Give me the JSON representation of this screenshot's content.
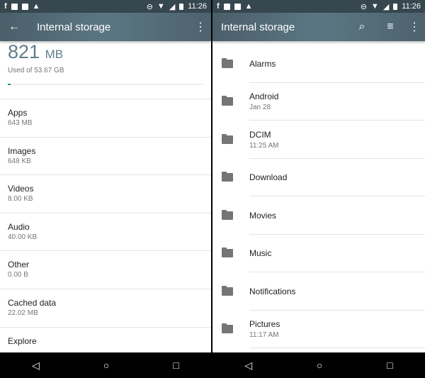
{
  "status": {
    "time": "11:26",
    "left_icons": [
      "facebook-icon",
      "image-icon",
      "gmail-icon",
      "warning-icon"
    ],
    "right_icons": [
      "do-not-disturb-icon",
      "wifi-icon",
      "signal-icon",
      "battery-icon"
    ]
  },
  "left": {
    "title": "Internal storage",
    "used_value": "821",
    "used_unit": "MB",
    "used_of": "Used of 53.67 GB",
    "progress_percent": 1.5,
    "items": [
      {
        "title": "Apps",
        "sub": "643 MB"
      },
      {
        "title": "Images",
        "sub": "648 KB"
      },
      {
        "title": "Videos",
        "sub": "8.00 KB"
      },
      {
        "title": "Audio",
        "sub": "40.00 KB"
      },
      {
        "title": "Other",
        "sub": "0.00 B"
      },
      {
        "title": "Cached data",
        "sub": "22.02 MB"
      },
      {
        "title": "Explore",
        "sub": ""
      }
    ]
  },
  "right": {
    "title": "Internal storage",
    "folders": [
      {
        "name": "Alarms",
        "sub": ""
      },
      {
        "name": "Android",
        "sub": "Jan 28"
      },
      {
        "name": "DCIM",
        "sub": "11:25 AM"
      },
      {
        "name": "Download",
        "sub": ""
      },
      {
        "name": "Movies",
        "sub": ""
      },
      {
        "name": "Music",
        "sub": ""
      },
      {
        "name": "Notifications",
        "sub": ""
      },
      {
        "name": "Pictures",
        "sub": "11:17 AM"
      }
    ]
  },
  "colors": {
    "accent": "#009688",
    "toolbar": "#546e7a",
    "status": "#37474f"
  }
}
